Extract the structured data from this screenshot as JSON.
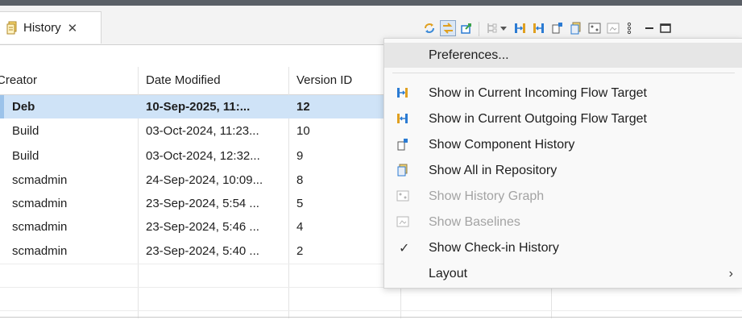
{
  "view_tab": {
    "label": "History",
    "close_glyph": "✕"
  },
  "table": {
    "columns": [
      "Creator",
      "Date Modified",
      "Version ID"
    ],
    "rows": [
      {
        "creator": "Deb",
        "date": "10-Sep-2025, 11:...",
        "version": "12",
        "selected": true
      },
      {
        "creator": "Build",
        "date": "03-Oct-2024, 11:23...",
        "version": "10"
      },
      {
        "creator": "Build",
        "date": "03-Oct-2024, 12:32...",
        "version": "9"
      },
      {
        "creator": "scmadmin",
        "date": "24-Sep-2024, 10:09...",
        "version": "8"
      },
      {
        "creator": "scmadmin",
        "date": "23-Sep-2024, 5:54 ...",
        "version": "5"
      },
      {
        "creator": "scmadmin",
        "date": "23-Sep-2024, 5:46 ...",
        "version": "4"
      },
      {
        "creator": "scmadmin",
        "date": "23-Sep-2024, 5:40 ...",
        "version": "2"
      }
    ]
  },
  "menu": {
    "preferences": "Preferences...",
    "incoming": "Show in Current Incoming Flow Target",
    "outgoing": "Show in Current Outgoing Flow Target",
    "component_history": "Show Component History",
    "all_in_repo": "Show All in Repository",
    "history_graph": "Show History Graph",
    "baselines": "Show Baselines",
    "checkin_history": "Show Check-in History",
    "layout": "Layout",
    "check_glyph": "✓",
    "submenu_arrow": "›"
  },
  "icons": {
    "tab": "history-view-icon",
    "toolbar": [
      "refresh-icon",
      "link-with-selection-icon",
      "pin-icon",
      "compare-dropdown-icon",
      "incoming-flow-icon",
      "outgoing-flow-icon",
      "component-history-icon",
      "repository-icon",
      "history-graph-icon",
      "baselines-icon",
      "view-menu-icon",
      "minimize-icon",
      "maximize-icon"
    ]
  },
  "colors": {
    "selection": "#cfe3f7",
    "accent": "#2b7bd3",
    "disabled_text": "#a3a3a3"
  }
}
